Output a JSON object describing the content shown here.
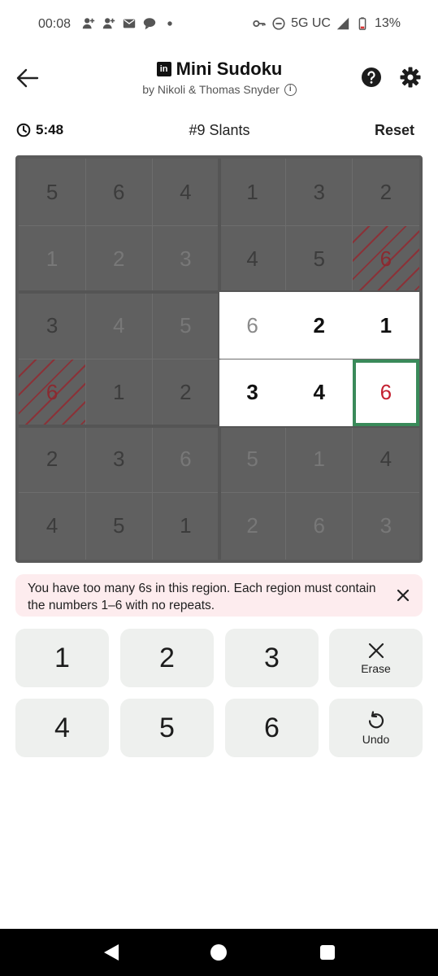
{
  "status_bar": {
    "time": "00:08",
    "network": "5G UC",
    "battery": "13%"
  },
  "header": {
    "title": "Mini Sudoku",
    "byline": "by Nikoli & Thomas Snyder"
  },
  "info_row": {
    "timer": "5:48",
    "puzzle_name": "#9 Slants",
    "reset_label": "Reset"
  },
  "grid": {
    "rows": [
      [
        {
          "v": "5",
          "style": "dark",
          "tone": "normal"
        },
        {
          "v": "6",
          "style": "dark",
          "tone": "normal"
        },
        {
          "v": "4",
          "style": "dark",
          "tone": "normal"
        },
        {
          "v": "1",
          "style": "dark",
          "tone": "normal"
        },
        {
          "v": "3",
          "style": "dark",
          "tone": "normal"
        },
        {
          "v": "2",
          "style": "dark",
          "tone": "normal"
        }
      ],
      [
        {
          "v": "1",
          "style": "dark",
          "tone": "dim"
        },
        {
          "v": "2",
          "style": "dark",
          "tone": "dim"
        },
        {
          "v": "3",
          "style": "dark",
          "tone": "dim"
        },
        {
          "v": "4",
          "style": "dark",
          "tone": "normal"
        },
        {
          "v": "5",
          "style": "dark",
          "tone": "normal"
        },
        {
          "v": "6",
          "style": "hatch-dark",
          "tone": "error"
        }
      ],
      [
        {
          "v": "3",
          "style": "dark",
          "tone": "normal"
        },
        {
          "v": "4",
          "style": "dark",
          "tone": "dim"
        },
        {
          "v": "5",
          "style": "dark",
          "tone": "dim"
        },
        {
          "v": "6",
          "style": "hatch-white",
          "tone": "given"
        },
        {
          "v": "2",
          "style": "white",
          "tone": "normal"
        },
        {
          "v": "1",
          "style": "white",
          "tone": "normal"
        }
      ],
      [
        {
          "v": "6",
          "style": "hatch-dark",
          "tone": "error"
        },
        {
          "v": "1",
          "style": "dark",
          "tone": "normal"
        },
        {
          "v": "2",
          "style": "dark",
          "tone": "normal"
        },
        {
          "v": "3",
          "style": "white",
          "tone": "normal"
        },
        {
          "v": "4",
          "style": "white",
          "tone": "normal"
        },
        {
          "v": "6",
          "style": "hatch-sel",
          "tone": "error"
        }
      ],
      [
        {
          "v": "2",
          "style": "dark",
          "tone": "normal"
        },
        {
          "v": "3",
          "style": "dark",
          "tone": "normal"
        },
        {
          "v": "6",
          "style": "dark",
          "tone": "dim"
        },
        {
          "v": "5",
          "style": "dark",
          "tone": "dim"
        },
        {
          "v": "1",
          "style": "dark",
          "tone": "dim"
        },
        {
          "v": "4",
          "style": "dark",
          "tone": "normal"
        }
      ],
      [
        {
          "v": "4",
          "style": "dark",
          "tone": "normal"
        },
        {
          "v": "5",
          "style": "dark",
          "tone": "normal"
        },
        {
          "v": "1",
          "style": "dark",
          "tone": "normal"
        },
        {
          "v": "2",
          "style": "dark",
          "tone": "dim"
        },
        {
          "v": "6",
          "style": "dark",
          "tone": "dim"
        },
        {
          "v": "3",
          "style": "dark",
          "tone": "dim"
        }
      ]
    ],
    "selected_color": "#3a8a5a",
    "error_color": "#d01e32"
  },
  "alert": {
    "message": "You have too many 6s in this region. Each region must contain the numbers 1–6 with no repeats."
  },
  "keypad": {
    "keys": [
      "1",
      "2",
      "3",
      "4",
      "5",
      "6"
    ],
    "erase_label": "Erase",
    "undo_label": "Undo"
  }
}
